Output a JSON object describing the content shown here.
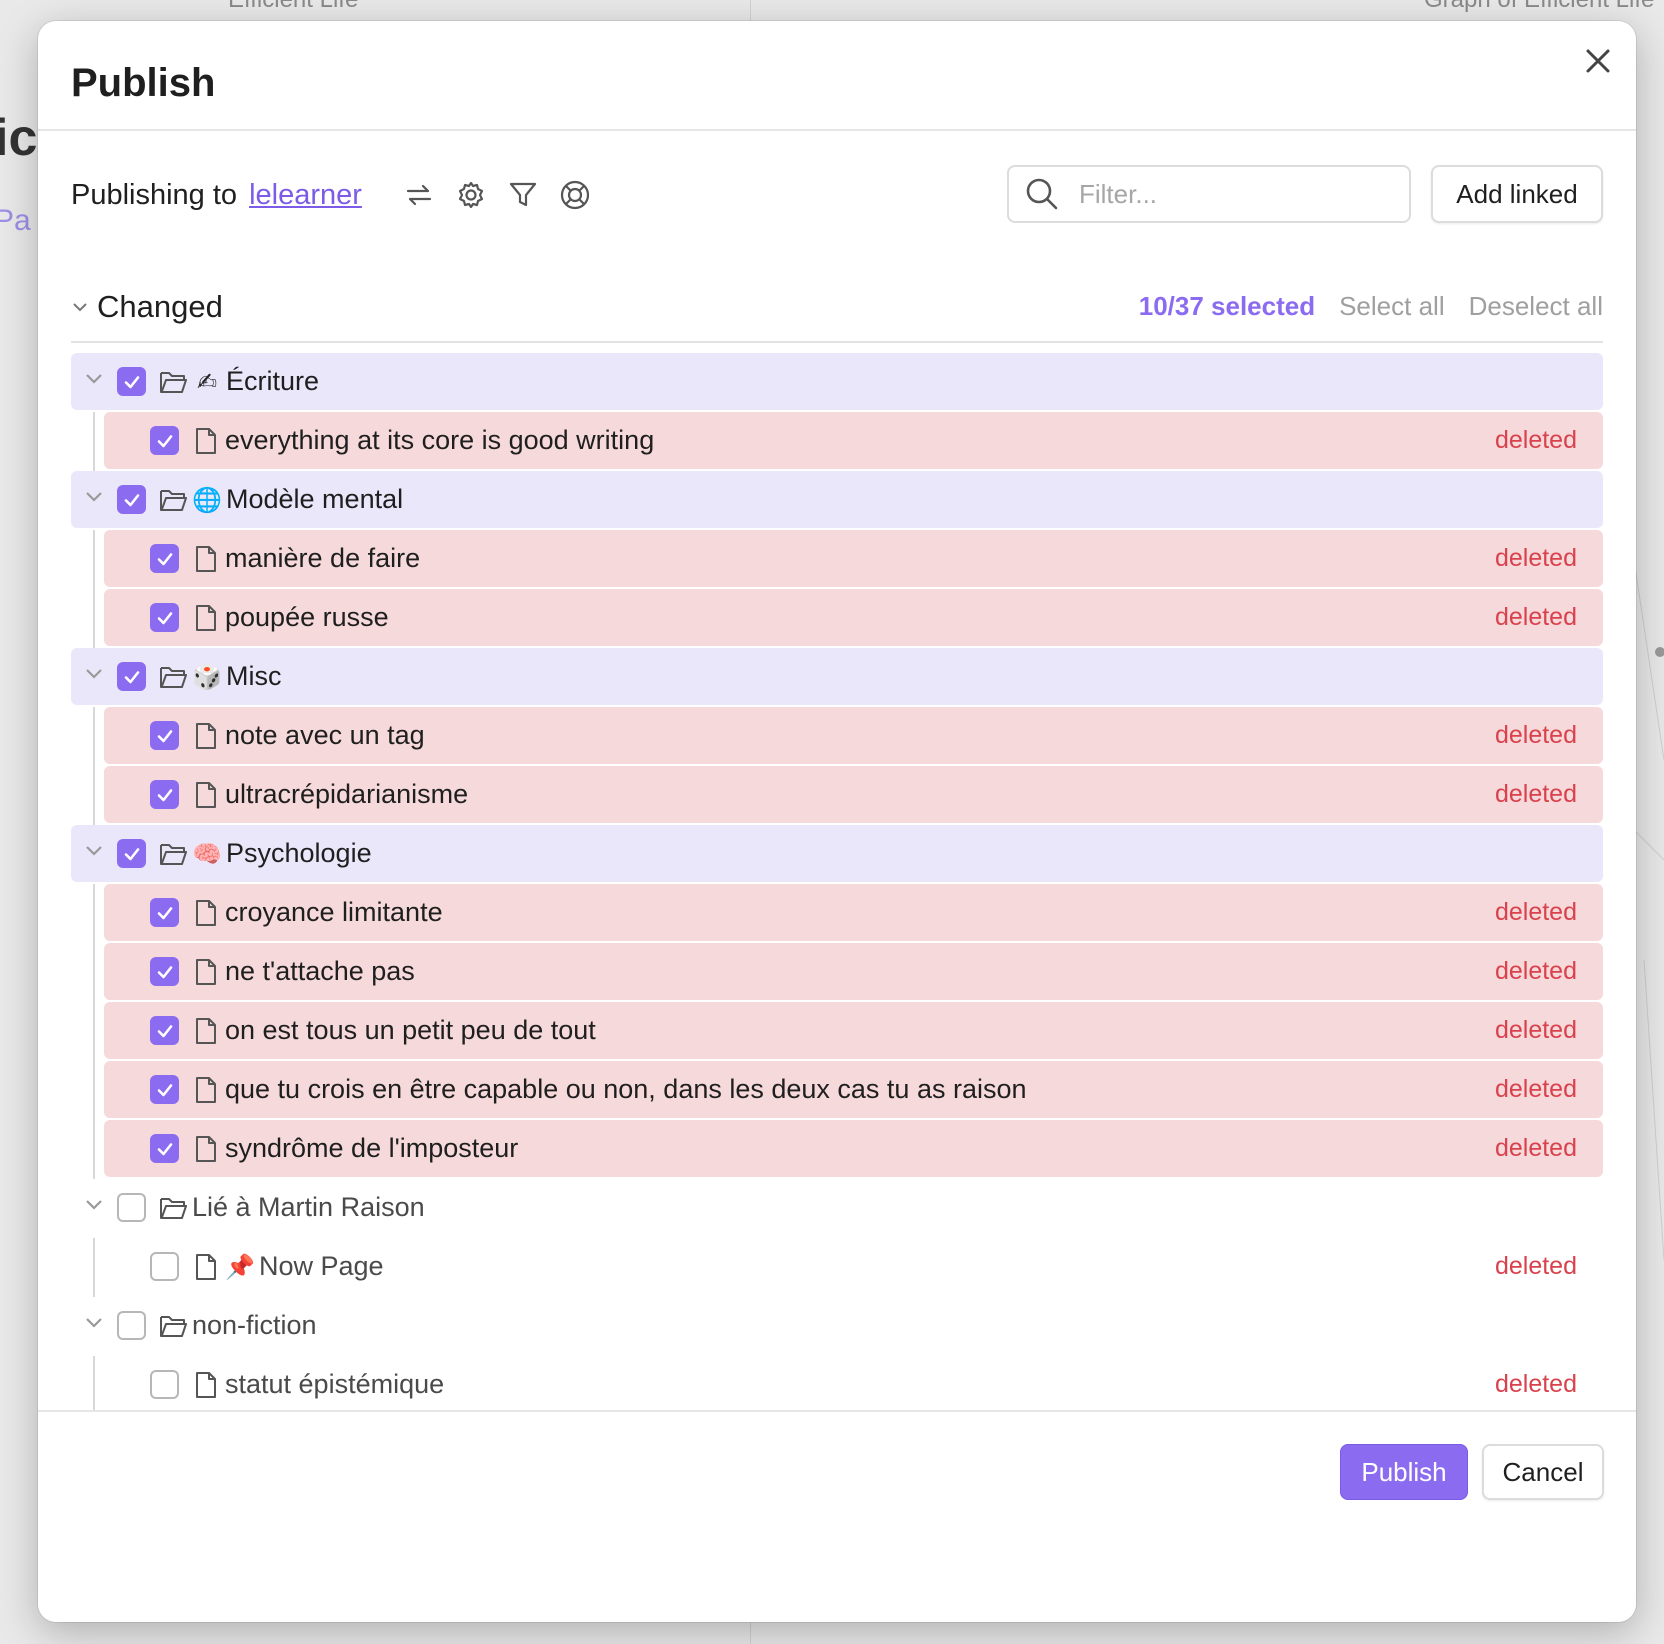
{
  "background": {
    "left_title": "Efficient Life",
    "right_title": "Graph of Efficient Life",
    "heading_fragment": "ic",
    "link_fragment": "Pa"
  },
  "modal": {
    "title": "Publish",
    "publishing_to_label": "Publishing to",
    "site_name": "lelearner",
    "filter_placeholder": "Filter...",
    "add_linked_label": "Add linked",
    "section_label": "Changed",
    "selected_count": "10/37 selected",
    "select_all_label": "Select all",
    "deselect_all_label": "Deselect all",
    "publish_label": "Publish",
    "cancel_label": "Cancel"
  },
  "tree": [
    {
      "type": "folder",
      "checked": true,
      "emoji": "✍",
      "name": "Écriture"
    },
    {
      "type": "file",
      "checked": true,
      "name": "everything at its core is good writing",
      "status": "deleted"
    },
    {
      "type": "folder",
      "checked": true,
      "emoji": "🌐",
      "name": "Modèle mental"
    },
    {
      "type": "file",
      "checked": true,
      "name": "manière de faire",
      "status": "deleted"
    },
    {
      "type": "file",
      "checked": true,
      "name": "poupée russe",
      "status": "deleted"
    },
    {
      "type": "folder",
      "checked": true,
      "emoji": "🎲",
      "name": "Misc"
    },
    {
      "type": "file",
      "checked": true,
      "name": "note avec un tag",
      "status": "deleted"
    },
    {
      "type": "file",
      "checked": true,
      "name": "ultracrépidarianisme",
      "status": "deleted"
    },
    {
      "type": "folder",
      "checked": true,
      "emoji": "🧠",
      "name": "Psychologie"
    },
    {
      "type": "file",
      "checked": true,
      "name": "croyance limitante",
      "status": "deleted"
    },
    {
      "type": "file",
      "checked": true,
      "name": "ne t'attache pas",
      "status": "deleted"
    },
    {
      "type": "file",
      "checked": true,
      "name": "on est tous un petit peu de tout",
      "status": "deleted"
    },
    {
      "type": "file",
      "checked": true,
      "name": "que tu crois en être capable ou non, dans les deux cas tu as raison",
      "status": "deleted"
    },
    {
      "type": "file",
      "checked": true,
      "name": "syndrôme de l'imposteur",
      "status": "deleted"
    },
    {
      "type": "folder",
      "checked": false,
      "emoji": "",
      "name": "Lié à Martin Raison"
    },
    {
      "type": "file",
      "checked": false,
      "emoji": "📌",
      "name": "Now Page",
      "status": "deleted"
    },
    {
      "type": "folder",
      "checked": false,
      "emoji": "",
      "name": "non-fiction"
    },
    {
      "type": "file",
      "checked": false,
      "name": "statut épistémique",
      "status": "deleted"
    }
  ],
  "colors": {
    "accent": "#8b6bf0",
    "folder_row_bg": "#ebe7fb",
    "file_row_bg": "#f6d9da",
    "deleted_text": "#d9424d"
  }
}
